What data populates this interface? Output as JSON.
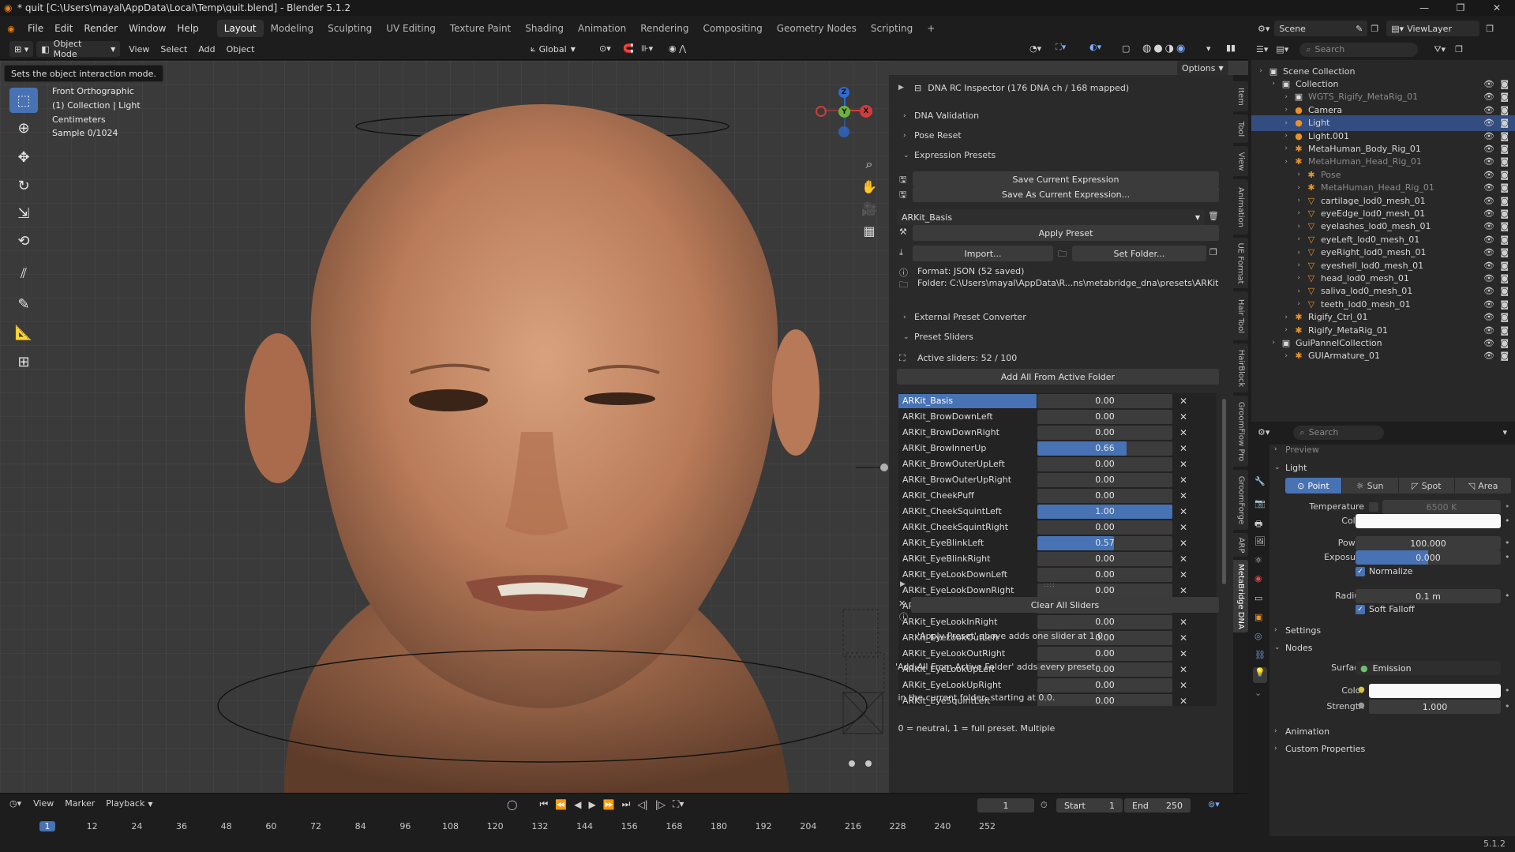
{
  "title": "* quit [C:\\Users\\mayal\\AppData\\Local\\Temp\\quit.blend] - Blender 5.1.2",
  "menus": [
    "File",
    "Edit",
    "Render",
    "Window",
    "Help"
  ],
  "workspaces": [
    "Layout",
    "Modeling",
    "Sculpting",
    "UV Editing",
    "Texture Paint",
    "Shading",
    "Animation",
    "Rendering",
    "Compositing",
    "Geometry Nodes",
    "Scripting"
  ],
  "active_workspace": "Layout",
  "top_right": {
    "scene": "Scene",
    "viewlayer": "ViewLayer"
  },
  "viewport_header": {
    "mode": "Object Mode",
    "menus": [
      "View",
      "Select",
      "Add",
      "Object"
    ],
    "orientation": "Global",
    "options": "Options"
  },
  "tooltip": "Sets the object interaction mode.",
  "viewport_info": [
    "Front Orthographic",
    "(1) Collection | Light",
    "Centimeters",
    "Sample 0/1024"
  ],
  "gizmo": {
    "x": "X",
    "y": "Y",
    "z": "Z"
  },
  "npanel": {
    "inspector": "DNA RC Inspector  (176 DNA ch / 168 mapped)",
    "dna_validation": "DNA Validation",
    "pose_reset": "Pose Reset",
    "expression_presets": "Expression Presets",
    "save_current": "Save Current Expression",
    "save_as_current": "Save As Current Expression...",
    "preset_select": "ARKit_Basis",
    "apply_preset": "Apply Preset",
    "import": "Import...",
    "set_folder": "Set Folder...",
    "format": "Format: JSON  (52 saved)",
    "folder": "Folder: C:\\Users\\mayal\\AppData\\R...ns\\metabridge_dna\\presets\\ARKit",
    "external_converter": "External Preset Converter",
    "preset_sliders": "Preset Sliders",
    "active_sliders": "Active sliders: 52 / 100",
    "add_all": "Add All From Active Folder",
    "sliders": [
      {
        "name": "ARKit_Basis",
        "value": 0.0,
        "label": "0.00",
        "selected": true
      },
      {
        "name": "ARKit_BrowDownLeft",
        "value": 0.0,
        "label": "0.00"
      },
      {
        "name": "ARKit_BrowDownRight",
        "value": 0.0,
        "label": "0.00"
      },
      {
        "name": "ARKit_BrowInnerUp",
        "value": 0.66,
        "label": "0.66"
      },
      {
        "name": "ARKit_BrowOuterUpLeft",
        "value": 0.0,
        "label": "0.00"
      },
      {
        "name": "ARKit_BrowOuterUpRight",
        "value": 0.0,
        "label": "0.00"
      },
      {
        "name": "ARKit_CheekPuff",
        "value": 0.0,
        "label": "0.00"
      },
      {
        "name": "ARKit_CheekSquintLeft",
        "value": 1.0,
        "label": "1.00"
      },
      {
        "name": "ARKit_CheekSquintRight",
        "value": 0.0,
        "label": "0.00"
      },
      {
        "name": "ARKit_EyeBlinkLeft",
        "value": 0.57,
        "label": "0.57"
      },
      {
        "name": "ARKit_EyeBlinkRight",
        "value": 0.0,
        "label": "0.00"
      },
      {
        "name": "ARKit_EyeLookDownLeft",
        "value": 0.0,
        "label": "0.00"
      },
      {
        "name": "ARKit_EyeLookDownRight",
        "value": 0.0,
        "label": "0.00"
      },
      {
        "name": "ARKit_EyeLookInLeft",
        "value": 0.0,
        "label": "0.00"
      },
      {
        "name": "ARKit_EyeLookInRight",
        "value": 0.0,
        "label": "0.00"
      },
      {
        "name": "ARKit_EyeLookOutLeft",
        "value": 0.0,
        "label": "0.00"
      },
      {
        "name": "ARKit_EyeLookOutRight",
        "value": 0.0,
        "label": "0.00"
      },
      {
        "name": "ARKit_EyeLookUpLeft",
        "value": 0.0,
        "label": "0.00"
      },
      {
        "name": "ARKit_EyeLookUpRight",
        "value": 0.0,
        "label": "0.00"
      },
      {
        "name": "ARKit_EyeSquintLeft",
        "value": 0.0,
        "label": "0.00"
      }
    ],
    "clear_all": "Clear All Sliders",
    "help_lines": [
      "'Apply Preset' above adds one slider at 1.0.",
      "'Add All From Active Folder' adds every preset",
      " in the current folder, starting at 0.0.",
      " 0 = neutral, 1 = full preset. Multiple"
    ]
  },
  "vtabs": [
    "Item",
    "Tool",
    "View",
    "Animation",
    "UE Format",
    "Hair Tool",
    "HairBlock",
    "GroomFlow Pro",
    "GroomForge",
    "ARP",
    "MetaBridge DNA"
  ],
  "active_vtab": "MetaBridge DNA",
  "outliner": {
    "search_placeholder": "Search",
    "items": [
      {
        "name": "Scene Collection",
        "indent": 0,
        "icon": "▣"
      },
      {
        "name": "Collection",
        "indent": 1,
        "icon": "▣"
      },
      {
        "name": "WGTS_Rigify_MetaRig_01",
        "indent": 2,
        "icon": "▣",
        "dim": true
      },
      {
        "name": "Camera",
        "indent": 2,
        "icon": "●"
      },
      {
        "name": "Light",
        "indent": 2,
        "icon": "●",
        "selected": true
      },
      {
        "name": "Light.001",
        "indent": 2,
        "icon": "●"
      },
      {
        "name": "MetaHuman_Body_Rig_01",
        "indent": 2,
        "icon": "✱"
      },
      {
        "name": "MetaHuman_Head_Rig_01",
        "indent": 2,
        "icon": "✱",
        "dim": true
      },
      {
        "name": "Pose",
        "indent": 3,
        "icon": "✱",
        "dim": true
      },
      {
        "name": "MetaHuman_Head_Rig_01",
        "indent": 3,
        "icon": "✱",
        "dim": true
      },
      {
        "name": "cartilage_lod0_mesh_01",
        "indent": 3,
        "icon": "▽"
      },
      {
        "name": "eyeEdge_lod0_mesh_01",
        "indent": 3,
        "icon": "▽"
      },
      {
        "name": "eyelashes_lod0_mesh_01",
        "indent": 3,
        "icon": "▽"
      },
      {
        "name": "eyeLeft_lod0_mesh_01",
        "indent": 3,
        "icon": "▽"
      },
      {
        "name": "eyeRight_lod0_mesh_01",
        "indent": 3,
        "icon": "▽"
      },
      {
        "name": "eyeshell_lod0_mesh_01",
        "indent": 3,
        "icon": "▽"
      },
      {
        "name": "head_lod0_mesh_01",
        "indent": 3,
        "icon": "▽"
      },
      {
        "name": "saliva_lod0_mesh_01",
        "indent": 3,
        "icon": "▽"
      },
      {
        "name": "teeth_lod0_mesh_01",
        "indent": 3,
        "icon": "▽"
      },
      {
        "name": "Rigify_Ctrl_01",
        "indent": 2,
        "icon": "✱"
      },
      {
        "name": "Rigify_MetaRig_01",
        "indent": 2,
        "icon": "✱"
      },
      {
        "name": "GuiPannelCollection",
        "indent": 1,
        "icon": "▣"
      },
      {
        "name": "GUIArmature_01",
        "indent": 2,
        "icon": "✱"
      }
    ]
  },
  "properties": {
    "search_placeholder": "Search",
    "preview": "Preview",
    "light_header": "Light",
    "light_types": [
      "Point",
      "Sun",
      "Spot",
      "Area"
    ],
    "active_type": "Point",
    "temperature_label": "Temperature",
    "temperature_value": "6500 K",
    "color_label": "Color",
    "power_label": "Power",
    "power_value": "100.000",
    "exposure_label": "Exposure",
    "exposure_value": "0.000",
    "normalize": "Normalize",
    "radius_label": "Radius",
    "radius_value": "0.1 m",
    "soft_falloff": "Soft Falloff",
    "settings": "Settings",
    "nodes": "Nodes",
    "surface_label": "Surface",
    "surface_value": "Emission",
    "color2_label": "Color",
    "strength_label": "Strength",
    "strength_value": "1.000",
    "animation": "Animation",
    "custom_props": "Custom Properties"
  },
  "timeline": {
    "menus": [
      "View",
      "Marker",
      "Playback"
    ],
    "current_frame": "1",
    "start_label": "Start",
    "start": "1",
    "end_label": "End",
    "end": "250",
    "ticks": [
      "1",
      "12",
      "24",
      "36",
      "48",
      "60",
      "72",
      "84",
      "96",
      "108",
      "120",
      "132",
      "144",
      "156",
      "168",
      "180",
      "192",
      "204",
      "216",
      "228",
      "240",
      "252"
    ]
  },
  "version": "5.1.2"
}
